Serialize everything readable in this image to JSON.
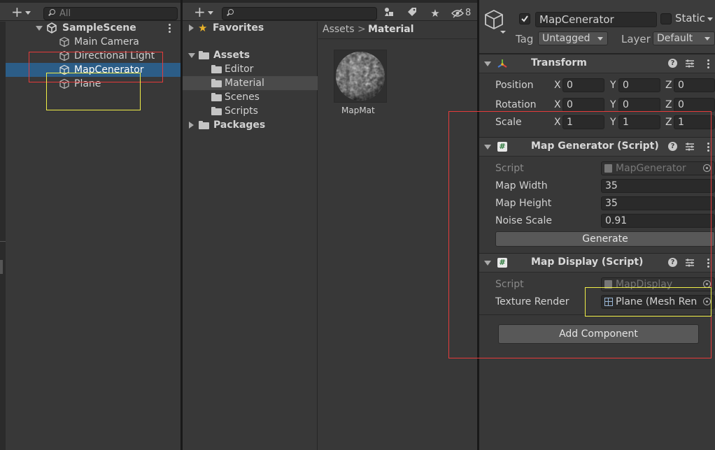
{
  "hierarchy": {
    "search_placeholder": "All",
    "scene_name": "SampleScene",
    "items": [
      {
        "label": "Main Camera"
      },
      {
        "label": "Directional Light"
      },
      {
        "label": "MapCenerator"
      },
      {
        "label": "Plane"
      }
    ]
  },
  "project": {
    "search_placeholder": "",
    "hidden_count": "8",
    "tree": {
      "favorites": "Favorites",
      "assets": "Assets",
      "folders": [
        "Editor",
        "Material",
        "Scenes",
        "Scripts"
      ],
      "packages": "Packages"
    },
    "breadcrumb": {
      "root": "Assets",
      "separator": ">",
      "current": "Material"
    },
    "asset": {
      "name": "MapMat"
    }
  },
  "inspector": {
    "object_name": "MapCenerator",
    "static_label": "Static",
    "tag_label": "Tag",
    "tag_value": "Untagged",
    "layer_label": "Layer",
    "layer_value": "Default",
    "transform": {
      "title": "Transform",
      "rows": [
        {
          "label": "Position",
          "x": "0",
          "y": "0",
          "z": "0"
        },
        {
          "label": "Rotation",
          "x": "0",
          "y": "0",
          "z": "0"
        },
        {
          "label": "Scale",
          "x": "1",
          "y": "1",
          "z": "1"
        }
      ],
      "axes": [
        "X",
        "Y",
        "Z"
      ]
    },
    "map_generator": {
      "title": "Map Generator (Script)",
      "script_label": "Script",
      "script_value": "MapGenerator",
      "fields": [
        {
          "label": "Map Width",
          "value": "35"
        },
        {
          "label": "Map Height",
          "value": "35"
        },
        {
          "label": "Noise Scale",
          "value": "0.91"
        }
      ],
      "button": "Generate"
    },
    "map_display": {
      "title": "Map Display (Script)",
      "script_label": "Script",
      "script_value": "MapDisplay",
      "texture_label": "Texture Render",
      "texture_value": "Plane (Mesh Ren"
    },
    "add_component": "Add Component"
  },
  "colors": {
    "selection": "#2c5d87",
    "highlight_red": "#e53b3b",
    "highlight_yellow": "#f0ee47"
  }
}
